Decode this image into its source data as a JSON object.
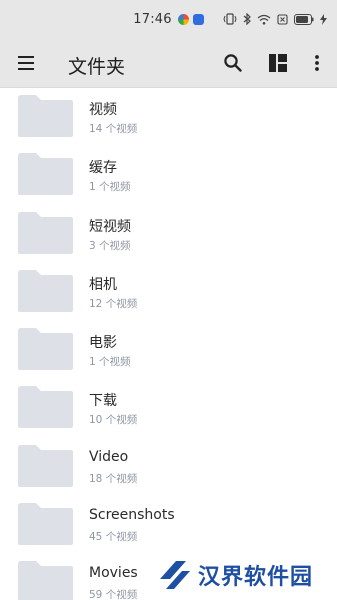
{
  "status_bar": {
    "time": "17:46",
    "app_icons": [
      "colorful-app-icon",
      "blue-app-icon"
    ],
    "right_icons": [
      "vibrate-icon",
      "bluetooth-icon",
      "wifi-icon",
      "sim-icon",
      "battery-icon",
      "charging-icon"
    ]
  },
  "toolbar": {
    "title": "文件夹",
    "menu_icon": "menu-icon",
    "search_icon": "search-icon",
    "layout_icon": "layout-icon",
    "more_icon": "more-vert-icon"
  },
  "folders": [
    {
      "name": "视频",
      "count": "14 个视频"
    },
    {
      "name": "缓存",
      "count": "1 个视频"
    },
    {
      "name": "短视频",
      "count": "3 个视频"
    },
    {
      "name": "相机",
      "count": "12 个视频"
    },
    {
      "name": "电影",
      "count": "1 个视频"
    },
    {
      "name": "下载",
      "count": "10 个视频"
    },
    {
      "name": "Video",
      "count": "18 个视频"
    },
    {
      "name": "Screenshots",
      "count": "45 个视频"
    },
    {
      "name": "Movies",
      "count": "59 个视频"
    }
  ],
  "watermark": {
    "text": "汉界软件园"
  },
  "colors": {
    "toolbar_bg": "#e7e7e7",
    "folder_fill": "#dde1e7",
    "count_text": "#8f96a3",
    "watermark_blue": "#1d4fa3"
  }
}
